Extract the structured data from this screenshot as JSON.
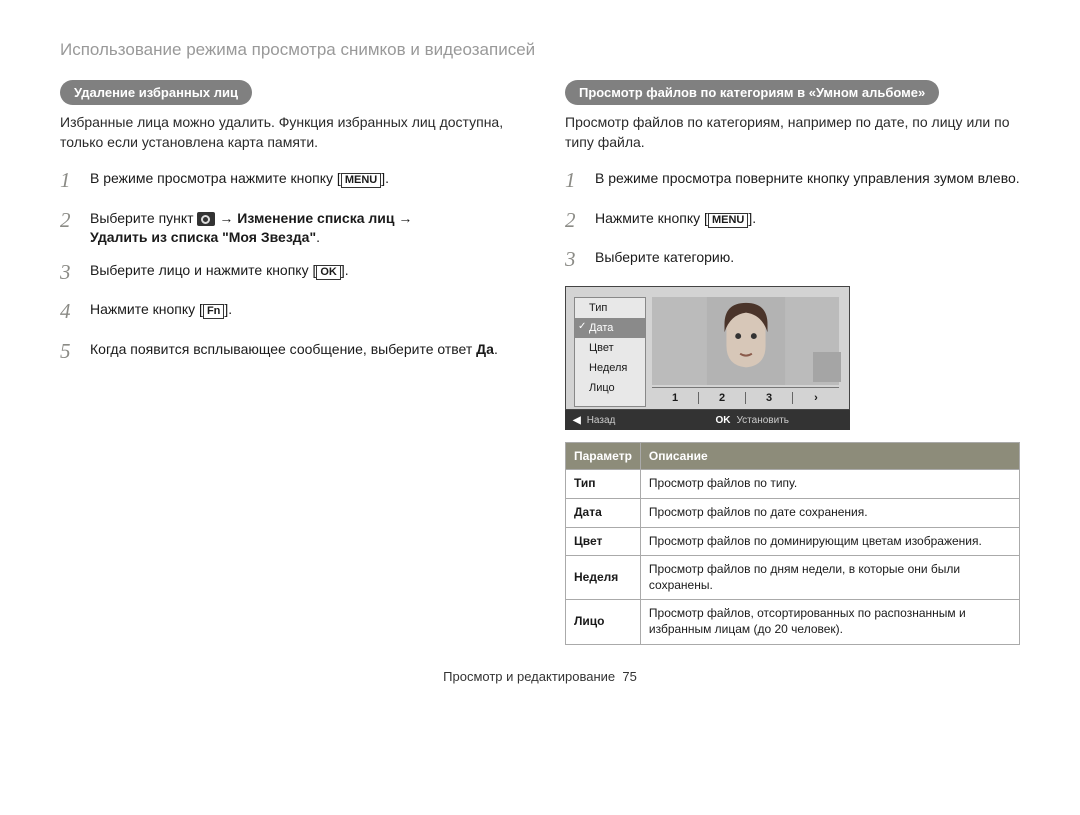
{
  "header": {
    "title": "Использование режима просмотра снимков и видеозаписей"
  },
  "left": {
    "pill": "Удаление избранных лиц",
    "intro": "Избранные лица можно удалить. Функция избранных лиц доступна, только если установлена карта памяти.",
    "steps": {
      "s1": {
        "num": "1",
        "pre": "В режиме просмотра нажмите кнопку [",
        "key": "MENU",
        "post": "]."
      },
      "s2": {
        "num": "2",
        "pre": "Выберите пункт ",
        "arrow1": "→ ",
        "bold1": "Изменение списка лиц",
        "arrow2": " →",
        "bold2": "Удалить из списка \"Моя Звезда\"",
        "post": "."
      },
      "s3": {
        "num": "3",
        "pre": "Выберите лицо и нажмите кнопку [",
        "key": "OK",
        "post": "]."
      },
      "s4": {
        "num": "4",
        "pre": "Нажмите кнопку [",
        "key": "Fn",
        "post": "]."
      },
      "s5": {
        "num": "5",
        "text_a": "Когда появится всплывающее сообщение, выберите ответ ",
        "bold": "Да",
        "text_b": "."
      }
    }
  },
  "right": {
    "pill": "Просмотр файлов по категориям в «Умном альбоме»",
    "intro": "Просмотр файлов по категориям, например по дате, по лицу или по типу файла.",
    "steps": {
      "s1": {
        "num": "1",
        "text": "В режиме просмотра поверните кнопку управления зумом влево."
      },
      "s2": {
        "num": "2",
        "pre": "Нажмите кнопку [",
        "key": "MENU",
        "post": "]."
      },
      "s3": {
        "num": "3",
        "text": "Выберите категорию."
      }
    },
    "sa": {
      "menu": {
        "i1": "Тип",
        "i2": "Дата",
        "i3": "Цвет",
        "i4": "Неделя",
        "i5": "Лицо"
      },
      "pager": {
        "p1": "1",
        "p2": "2",
        "p3": "3",
        "p4": "›"
      },
      "footer": {
        "back_arrow": "◀",
        "back": "Назад",
        "ok": "OK",
        "set": "Установить"
      }
    },
    "table": {
      "h1": "Параметр",
      "h2": "Описание",
      "r1": {
        "c1": "Тип",
        "c2": "Просмотр файлов по типу."
      },
      "r2": {
        "c1": "Дата",
        "c2": "Просмотр файлов по дате сохранения."
      },
      "r3": {
        "c1": "Цвет",
        "c2": "Просмотр файлов по доминирующим цветам изображения."
      },
      "r4": {
        "c1": "Неделя",
        "c2": "Просмотр файлов по дням недели, в которые они были сохранены."
      },
      "r5": {
        "c1": "Лицо",
        "c2": "Просмотр файлов, отсортированных по распознанным и избранным лицам (до 20 человек)."
      }
    }
  },
  "footer": {
    "section": "Просмотр и редактирование",
    "page": "75"
  }
}
